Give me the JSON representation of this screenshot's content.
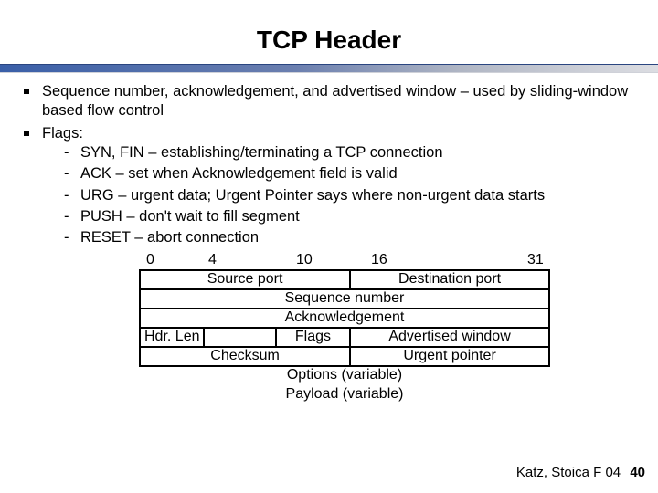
{
  "title": "TCP Header",
  "bullets": {
    "b1": "Sequence number, acknowledgement, and advertised window – used by sliding-window based flow control",
    "b2": "Flags:"
  },
  "flags": {
    "f1": "SYN, FIN – establishing/terminating a TCP connection",
    "f2": "ACK – set when Acknowledgement field is valid",
    "f3": "URG – urgent data; Urgent Pointer says where non-urgent data starts",
    "f4": "PUSH – don't wait to fill segment",
    "f5": "RESET – abort connection"
  },
  "bits": {
    "b0": "0",
    "b4": "4",
    "b10": "10",
    "b16": "16",
    "b31": "31"
  },
  "hdr": {
    "srcport": "Source port",
    "dstport": "Destination port",
    "seq": "Sequence number",
    "ack": "Acknowledgement",
    "hlen": "Hdr. Len",
    "flags": "Flags",
    "adv": "Advertised window",
    "chk": "Checksum",
    "urg": "Urgent pointer",
    "opts": "Options (variable)",
    "payload": "Payload (variable)"
  },
  "footer": {
    "credit": "Katz, Stoica F 04",
    "page": "40"
  }
}
